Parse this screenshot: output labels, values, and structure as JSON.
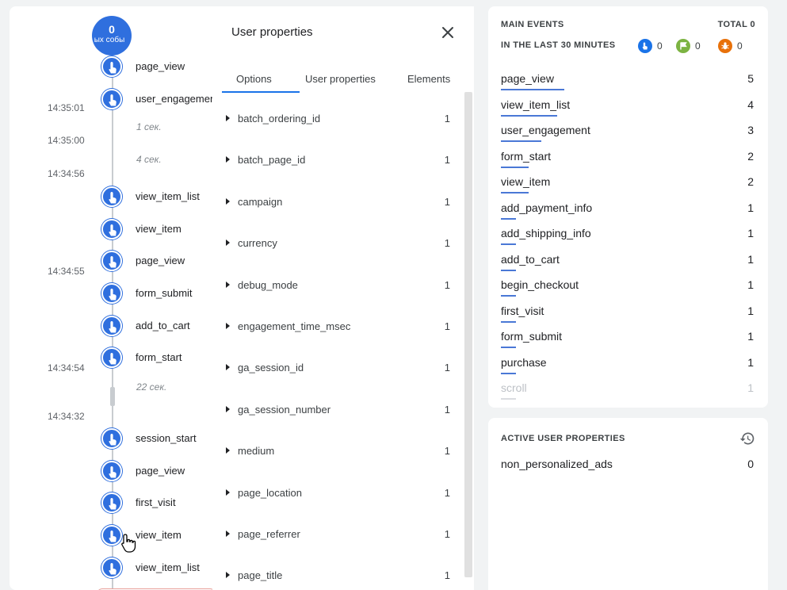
{
  "stream": {
    "badge": {
      "count": "0",
      "caption": "ых собы"
    },
    "time_labels": [
      "14:35:01",
      "14:35:00",
      "14:34:56",
      "14:34:55",
      "14:34:54",
      "14:34:32"
    ],
    "gap_notes": [
      "1 сек.",
      "4 сек.",
      "22 сек."
    ],
    "events": [
      "page_view",
      "user_engagement",
      "view_item_list",
      "view_item",
      "page_view",
      "form_submit",
      "add_to_cart",
      "form_start",
      "session_start",
      "page_view",
      "first_visit",
      "view_item",
      "view_item_list"
    ],
    "event_icon": "tap-hand-icon"
  },
  "panel": {
    "title": "User properties",
    "tabs": [
      "Options",
      "User properties",
      "Elements"
    ],
    "active_tab": "Options",
    "rows": [
      {
        "name": "batch_ordering_id",
        "count": "1"
      },
      {
        "name": "batch_page_id",
        "count": "1"
      },
      {
        "name": "campaign",
        "count": "1"
      },
      {
        "name": "currency",
        "count": "1"
      },
      {
        "name": "debug_mode",
        "count": "1"
      },
      {
        "name": "engagement_time_msec",
        "count": "1"
      },
      {
        "name": "ga_session_id",
        "count": "1"
      },
      {
        "name": "ga_session_number",
        "count": "1"
      },
      {
        "name": "medium",
        "count": "1"
      },
      {
        "name": "page_location",
        "count": "1"
      },
      {
        "name": "page_referrer",
        "count": "1"
      },
      {
        "name": "page_title",
        "count": "1"
      }
    ]
  },
  "main_events": {
    "title": "MAIN EVENTS",
    "total": "TOTAL 0",
    "subtitle": "IN THE LAST 30 MINUTES",
    "legend": [
      {
        "icon": "event-icon",
        "value": "0",
        "color": "#1a73e8"
      },
      {
        "icon": "conversion-flag-icon",
        "value": "0",
        "color": "#7cb342"
      },
      {
        "icon": "error-bug-icon",
        "value": "0",
        "color": "#e8710a"
      }
    ],
    "rows": [
      {
        "name": "page_view",
        "count": "5",
        "bar": 0.25
      },
      {
        "name": "view_item_list",
        "count": "4",
        "bar": 0.22
      },
      {
        "name": "user_engagement",
        "count": "3",
        "bar": 0.16
      },
      {
        "name": "form_start",
        "count": "2",
        "bar": 0.11
      },
      {
        "name": "view_item",
        "count": "2",
        "bar": 0.11
      },
      {
        "name": "add_payment_info",
        "count": "1",
        "bar": 0.06
      },
      {
        "name": "add_shipping_info",
        "count": "1",
        "bar": 0.06
      },
      {
        "name": "add_to_cart",
        "count": "1",
        "bar": 0.06
      },
      {
        "name": "begin_checkout",
        "count": "1",
        "bar": 0.06
      },
      {
        "name": "first_visit",
        "count": "1",
        "bar": 0.06
      },
      {
        "name": "form_submit",
        "count": "1",
        "bar": 0.06
      },
      {
        "name": "purchase",
        "count": "1",
        "bar": 0.06
      },
      {
        "name": "scroll",
        "count": "1",
        "bar": 0.06
      }
    ]
  },
  "active_user_properties": {
    "title": "ACTIVE USER PROPERTIES",
    "history_icon": "history-icon",
    "rows": [
      {
        "name": "non_personalized_ads",
        "value": "0"
      }
    ]
  }
}
